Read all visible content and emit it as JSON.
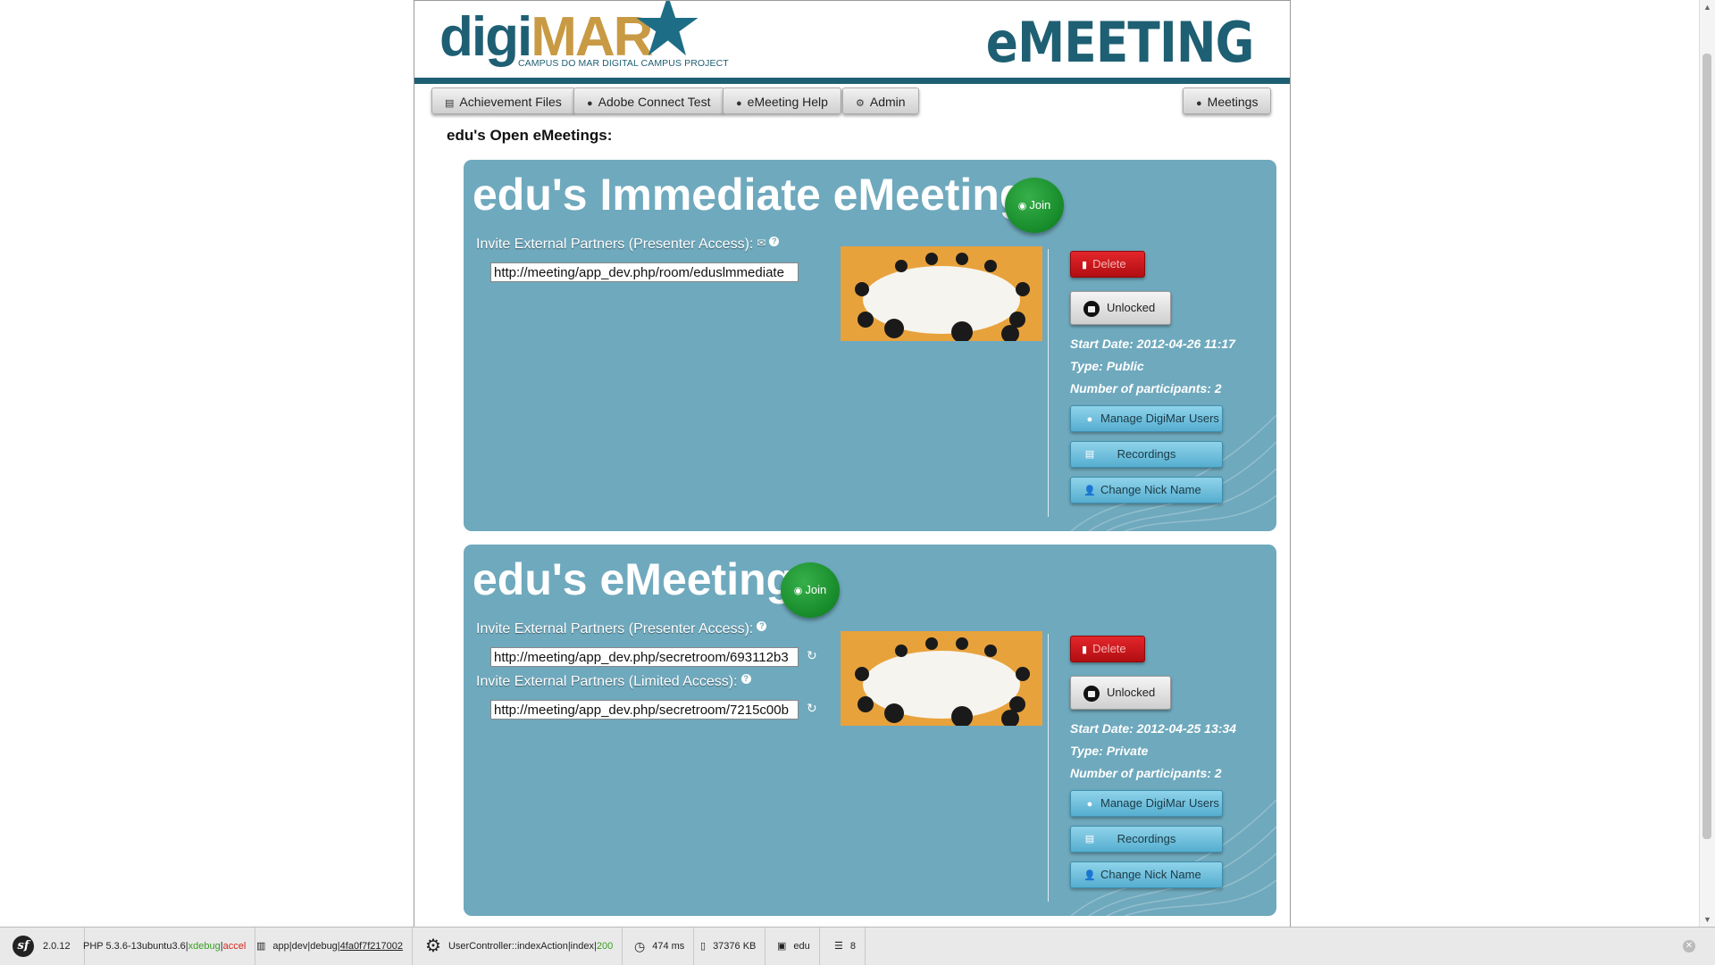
{
  "header": {
    "logo_part1": "digi",
    "logo_part2": "MAR",
    "logo_subtitle": "CAMPUS DO MAR DIGITAL CAMPUS  PROJECT",
    "app_title": "eMEETING"
  },
  "nav": {
    "achievement_files": "Achievement Files",
    "adobe_connect_test": "Adobe Connect Test",
    "emeeting_help": "eMeeting Help",
    "admin": "Admin",
    "meetings": "Meetings"
  },
  "section_title": "edu's Open eMeetings:",
  "meetings": [
    {
      "title": "edu's Immediate eMeeting",
      "join_label": "Join",
      "presenter_label": "Invite External Partners (Presenter Access):",
      "presenter_url": "http://meeting/app_dev.php/room/eduslmmediate",
      "delete_label": "Delete",
      "lock_label": "Unlocked",
      "start_date": "Start Date: 2012-04-26 11:17",
      "type": "Type: Public",
      "participants": "Number of participants: 2",
      "manage_users_label": "Manage DigiMar Users",
      "recordings_label": "Recordings",
      "change_nick_label": "Change Nick Name"
    },
    {
      "title": "edu's eMeeting",
      "join_label": "Join",
      "presenter_label": "Invite External Partners (Presenter Access):",
      "presenter_url": "http://meeting/app_dev.php/secretroom/693112b3",
      "limited_label": "Invite External Partners (Limited Access):",
      "limited_url": "http://meeting/app_dev.php/secretroom/7215c00b",
      "delete_label": "Delete",
      "lock_label": "Unlocked",
      "start_date": "Start Date: 2012-04-25 13:34",
      "type": "Type: Private",
      "participants": "Number of participants: 2",
      "manage_users_label": "Manage DigiMar Users",
      "recordings_label": "Recordings",
      "change_nick_label": "Change Nick Name"
    }
  ],
  "toolbar": {
    "symfony_version": "2.0.12",
    "php_version": "PHP 5.3.6-13ubuntu3.6",
    "php_xdebug": "xdebug",
    "php_accel": "accel",
    "env_prefix": "app|dev|debug|",
    "token": "4fa0f7f217002",
    "controller": "UserController::indexAction|index|",
    "status": "200",
    "time": "474 ms",
    "memory": "37376 KB",
    "user": "edu",
    "queries": "8"
  },
  "colors": {
    "brand_dark": "#1e5f73",
    "brand_gold": "#c99a44",
    "card_bg": "#6fa9bd",
    "join_green": "#178a2a",
    "delete_red": "#c4161b"
  }
}
